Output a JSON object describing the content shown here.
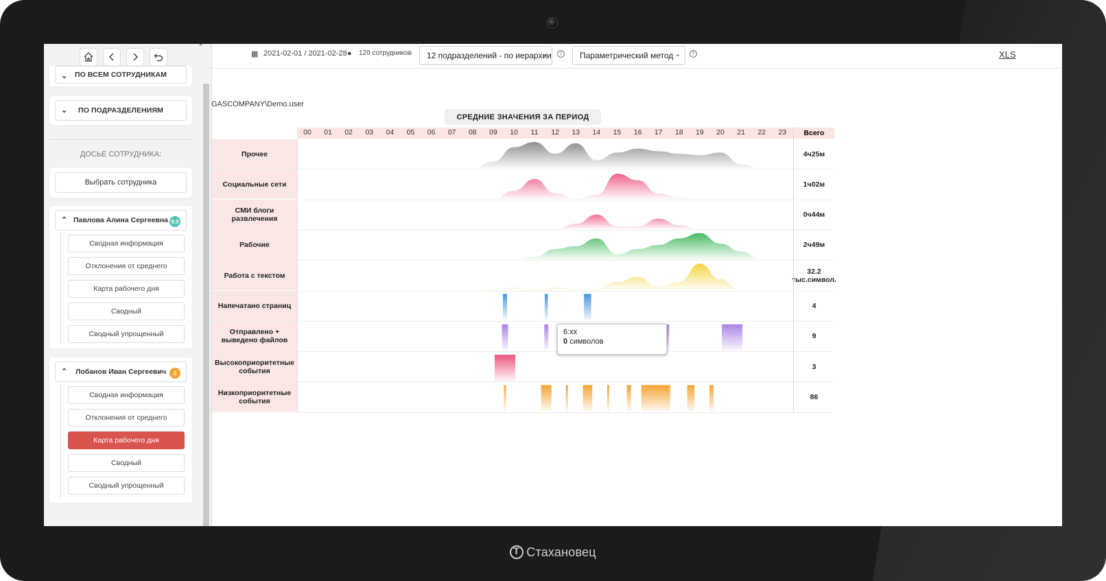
{
  "brand": {
    "name": "Стахановец"
  },
  "sidebar": {
    "nav": [
      "home-icon",
      "back-icon",
      "forward-icon",
      "undo-icon"
    ],
    "sections": [
      {
        "label": "ПО ВСЕМ СОТРУДНИКАМ",
        "expanded": false
      },
      {
        "label": "ПО ПОДРАЗДЕЛЕНИЯМ",
        "expanded": false
      }
    ],
    "dossier_label": "ДОСЬЕ СОТРУДНИКА:",
    "choose_employee": "Выбрать сотрудника",
    "employees": [
      {
        "name": "Павлова Алина Сергеевна",
        "badge": "9.9",
        "badge_color": "#4fc3b3",
        "items": [
          "Сводная информация",
          "Отклонения от среднего",
          "Карта рабочего дня",
          "Сводный",
          "Сводный упрощенный"
        ],
        "active_index": -1
      },
      {
        "name": "Лобанов Иван Сергеевич",
        "badge": "3",
        "badge_color": "#f0a62e",
        "items": [
          "Сводная информация",
          "Отклонения от среднего",
          "Карта рабочего дня",
          "Сводный",
          "Сводный упрощенный"
        ],
        "active_index": 2
      }
    ]
  },
  "topbar": {
    "period": "2021-02-01 / 2021-02-28",
    "employees_count": "120 сотрудников",
    "department_select": "12 подразделений - по иерархии",
    "method_select": "Параметрический метод",
    "xls": "XLS"
  },
  "content": {
    "user": "GASCOMPANY\\Demo.user",
    "period_title": "СРЕДНИЕ ЗНАЧЕНИЯ ЗА ПЕРИОД"
  },
  "chart_data": {
    "type": "heatmap",
    "title": "СРЕДНИЕ ЗНАЧЕНИЯ ЗА ПЕРИОД",
    "hours": [
      "00",
      "01",
      "02",
      "03",
      "04",
      "05",
      "06",
      "07",
      "08",
      "09",
      "10",
      "11",
      "12",
      "13",
      "14",
      "15",
      "16",
      "17",
      "18",
      "19",
      "20",
      "21",
      "22",
      "23"
    ],
    "total_header": "Всего",
    "rows": [
      {
        "label": "Прочее",
        "total": "4ч25м",
        "kind": "area",
        "color": "#8a8a8a",
        "values": [
          0,
          0,
          0,
          0,
          0,
          0,
          0,
          0,
          0,
          0.25,
          0.8,
          1.0,
          0.55,
          0.95,
          0.3,
          0.6,
          0.75,
          0.65,
          0.55,
          0.5,
          0.6,
          0.15,
          0,
          0
        ]
      },
      {
        "label": "Социальные сети",
        "total": "1ч02м",
        "kind": "area",
        "color": "#ea5a84",
        "values": [
          0,
          0,
          0,
          0,
          0,
          0,
          0,
          0,
          0,
          0,
          0.3,
          0.75,
          0.2,
          0,
          0.15,
          0.95,
          0.7,
          0.2,
          0.05,
          0,
          0,
          0,
          0,
          0
        ]
      },
      {
        "label": "СМИ блоги развлечения",
        "total": "0ч44м",
        "kind": "area",
        "color": "#ef6a8a",
        "values": [
          0,
          0,
          0,
          0,
          0,
          0,
          0,
          0,
          0,
          0,
          0,
          0,
          0,
          0.2,
          0.55,
          0.1,
          0.1,
          0.4,
          0.15,
          0,
          0,
          0,
          0,
          0
        ]
      },
      {
        "label": "Рабочие",
        "total": "2ч49м",
        "kind": "area",
        "color": "#3fb85a",
        "values": [
          0,
          0,
          0,
          0,
          0,
          0,
          0,
          0,
          0,
          0,
          0,
          0.1,
          0.4,
          0.5,
          0.8,
          0.2,
          0.4,
          0.55,
          0.8,
          1.0,
          0.6,
          0.3,
          0,
          0
        ]
      },
      {
        "label": "Работа с текстом",
        "total": "32.2 тыс.символ.",
        "kind": "area",
        "color": "#f1d23a",
        "values": [
          0,
          0,
          0,
          0,
          0,
          0,
          0,
          0,
          0,
          0.05,
          0.1,
          0.05,
          0.1,
          0.05,
          0.05,
          0.3,
          0.5,
          0.1,
          0.3,
          1.0,
          0.4,
          0,
          0,
          0
        ]
      },
      {
        "label": "Напечатано страниц",
        "total": "4",
        "kind": "bars",
        "color": "#3e8fde",
        "bars": [
          [
            10.0,
            0.2,
            1.0
          ],
          [
            12.0,
            0.15,
            1.0
          ],
          [
            14.0,
            0.35,
            1.0
          ]
        ]
      },
      {
        "label": "Отправлено + выведено файлов",
        "total": "9",
        "kind": "bars",
        "color": "#a77de6",
        "bars": [
          [
            10.0,
            0.3,
            1.0
          ],
          [
            12.0,
            0.2,
            1.0
          ],
          [
            17.8,
            0.3,
            1.0
          ],
          [
            21.0,
            1.0,
            1.0
          ]
        ]
      },
      {
        "label": "Высокоприоритетные события",
        "total": "3",
        "kind": "bars",
        "color": "#ec4e79",
        "bars": [
          [
            10.0,
            1.0,
            1.0
          ]
        ]
      },
      {
        "label": "Низкоприоритетные события",
        "total": "86",
        "kind": "bars",
        "color": "#f5a029",
        "bars": [
          [
            10.0,
            0.1,
            1.0
          ],
          [
            12.0,
            0.5,
            1.0
          ],
          [
            13.0,
            0.1,
            1.0
          ],
          [
            14.0,
            0.45,
            1.0
          ],
          [
            15.0,
            0.1,
            1.0
          ],
          [
            16.0,
            0.2,
            1.0
          ],
          [
            16.8,
            0.4,
            1.0
          ],
          [
            17.5,
            1.0,
            1.0
          ],
          [
            19.0,
            0.35,
            1.0
          ],
          [
            20.0,
            0.2,
            1.0
          ]
        ]
      }
    ],
    "tooltip": {
      "time": "6:xx",
      "value": "0",
      "unit": "символов"
    }
  }
}
